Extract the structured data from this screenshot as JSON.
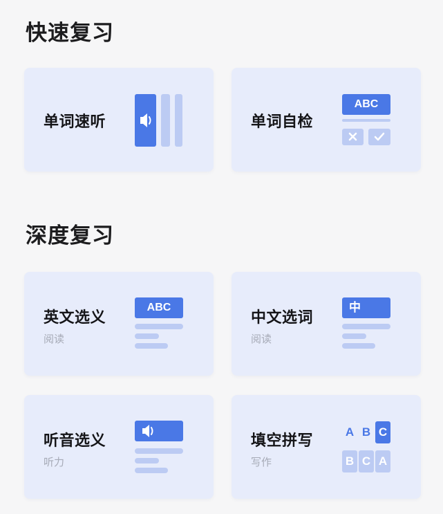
{
  "sections": {
    "quick": {
      "title": "快速复习"
    },
    "deep": {
      "title": "深度复习"
    }
  },
  "cards": {
    "word_listen": {
      "title": "单词速听"
    },
    "word_check": {
      "title": "单词自检",
      "badge": "ABC"
    },
    "en_choose": {
      "title": "英文选义",
      "subtitle": "阅读",
      "badge": "ABC"
    },
    "cn_choose": {
      "title": "中文选词",
      "subtitle": "阅读",
      "badge": "中"
    },
    "listen_choose": {
      "title": "听音选义",
      "subtitle": "听力"
    },
    "spell": {
      "title": "填空拼写",
      "subtitle": "写作",
      "letters_top": [
        "A",
        "B",
        "C"
      ],
      "letters_bottom": [
        "B",
        "C",
        "A"
      ]
    }
  },
  "colors": {
    "accent": "#4a78e6",
    "accent_light": "#bccbf3",
    "card_bg": "#e7ecfb",
    "page_bg": "#f6f6f7"
  },
  "icons": {
    "speaker": "speaker-icon",
    "cross": "cross-icon",
    "check": "check-icon"
  }
}
